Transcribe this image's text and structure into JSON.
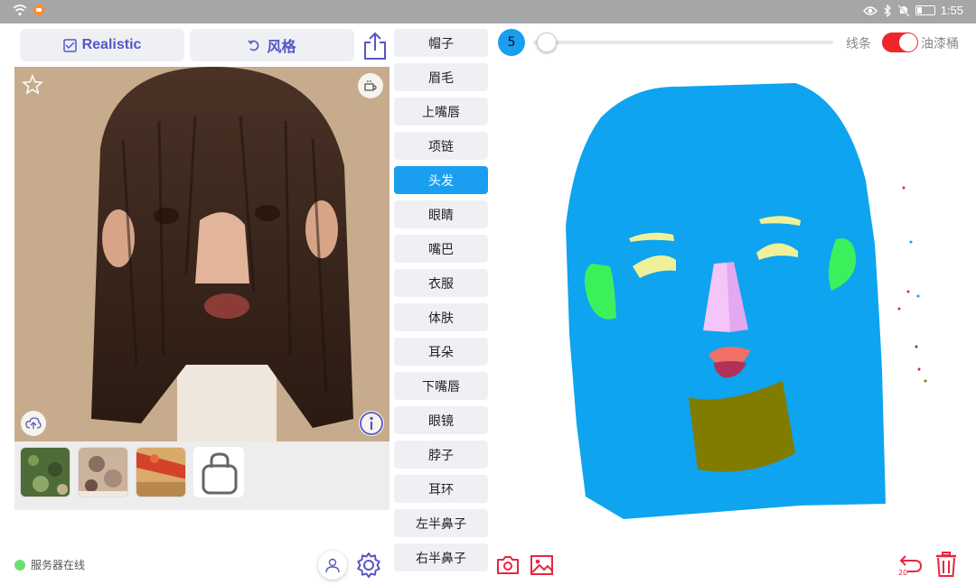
{
  "statusbar": {
    "time": "1:55",
    "battery_fraction": 0.3
  },
  "toolbar": {
    "realistic_label": "Realistic",
    "style_label": "风格"
  },
  "parts": {
    "selected_index": 4,
    "items": [
      "帽子",
      "眉毛",
      "上嘴唇",
      "项链",
      "头发",
      "眼睛",
      "嘴巴",
      "衣服",
      "体肤",
      "耳朵",
      "下嘴唇",
      "眼镜",
      "脖子",
      "耳环",
      "左半鼻子",
      "右半鼻子"
    ]
  },
  "brush": {
    "size": "5",
    "size_fraction": 0.02
  },
  "mode": {
    "line_label": "线条",
    "fill_label": "油漆桶",
    "fill_enabled": true
  },
  "status": {
    "server_text": "服务器在线",
    "undo_count": "20"
  },
  "colors": {
    "accent": "#1a9ff0",
    "toggle_on": "#f0242b",
    "online": "#6ee06e",
    "brand_text": "#5557c2",
    "delete": "#e8263f"
  },
  "icons": [
    "wifi-icon",
    "notification-icon",
    "eye-icon",
    "bluetooth-icon",
    "mute-icon",
    "battery-icon",
    "image-icon",
    "undo-icon",
    "share-icon",
    "star-icon",
    "coffee-icon",
    "upload-icon",
    "info-icon",
    "bag-icon",
    "user-icon",
    "gear-icon",
    "camera-icon",
    "gallery-icon",
    "trash-icon"
  ]
}
